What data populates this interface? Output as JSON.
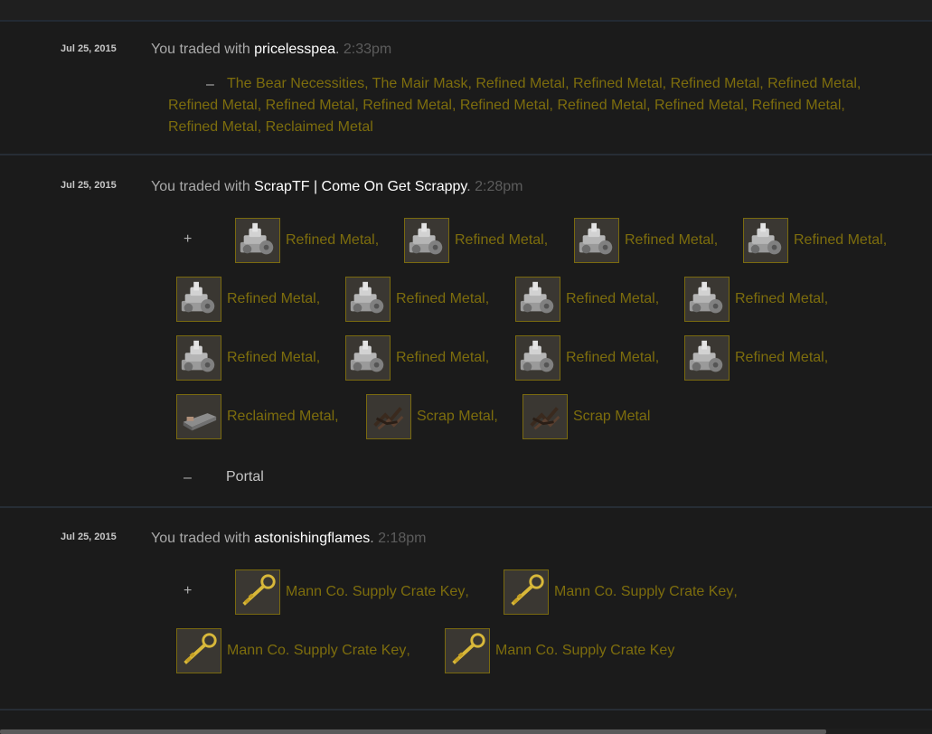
{
  "trades": [
    {
      "date": "Jul 25, 2015",
      "prefix": "You traded with ",
      "user": "pricelesspea",
      "dot": ".",
      "time": "2:33pm",
      "sign": "–",
      "line1": "The Bear Necessities, The Mair Mask, Refined Metal, Refined Metal, Refined Metal, Refined Metal,",
      "line2": "Refined Metal, Refined Metal, Refined Metal, Refined Metal, Refined Metal, Refined Metal, Refined Metal,",
      "line3": "Refined Metal, Reclaimed Metal"
    },
    {
      "date": "Jul 25, 2015",
      "prefix": "You traded with ",
      "user": "ScrapTF | Come On Get Scrappy",
      "dot": ".",
      "time": "2:28pm",
      "sign_received": "+",
      "sign_given": "–",
      "given": "Portal",
      "items": [
        {
          "name": "Refined Metal",
          "sep": ",",
          "icon": "refined-metal-icon"
        },
        {
          "name": "Refined Metal",
          "sep": ",",
          "icon": "refined-metal-icon"
        },
        {
          "name": "Refined Metal",
          "sep": ",",
          "icon": "refined-metal-icon"
        },
        {
          "name": "Refined Metal",
          "sep": ",",
          "icon": "refined-metal-icon"
        },
        {
          "name": "Refined Metal",
          "sep": ",",
          "icon": "refined-metal-icon"
        },
        {
          "name": "Refined Metal",
          "sep": ",",
          "icon": "refined-metal-icon"
        },
        {
          "name": "Refined Metal",
          "sep": ",",
          "icon": "refined-metal-icon"
        },
        {
          "name": "Refined Metal",
          "sep": ",",
          "icon": "refined-metal-icon"
        },
        {
          "name": "Refined Metal",
          "sep": ",",
          "icon": "refined-metal-icon"
        },
        {
          "name": "Refined Metal",
          "sep": ",",
          "icon": "refined-metal-icon"
        },
        {
          "name": "Refined Metal",
          "sep": ",",
          "icon": "refined-metal-icon"
        },
        {
          "name": "Refined Metal",
          "sep": ",",
          "icon": "refined-metal-icon"
        },
        {
          "name": "Reclaimed Metal",
          "sep": ",",
          "icon": "reclaimed-metal-icon"
        },
        {
          "name": "Scrap Metal",
          "sep": ",",
          "icon": "scrap-metal-icon"
        },
        {
          "name": "Scrap Metal",
          "sep": "",
          "icon": "scrap-metal-icon"
        }
      ]
    },
    {
      "date": "Jul 25, 2015",
      "prefix": "You traded with ",
      "user": "astonishingflames",
      "dot": ".",
      "time": "2:18pm",
      "sign_received": "+",
      "items": [
        {
          "name": "Mann Co. Supply Crate Key",
          "sep": ",",
          "icon": "key-icon"
        },
        {
          "name": "Mann Co. Supply Crate Key",
          "sep": ",",
          "icon": "key-icon"
        },
        {
          "name": "Mann Co. Supply Crate Key",
          "sep": ",",
          "icon": "key-icon"
        },
        {
          "name": "Mann Co. Supply Crate Key",
          "sep": "",
          "icon": "key-icon"
        }
      ]
    }
  ],
  "colors": {
    "item_text": "#7d6d0d",
    "user_text": "#ffffff",
    "time_text": "#5c5c5c",
    "tile_border": "#7a6a0f"
  }
}
